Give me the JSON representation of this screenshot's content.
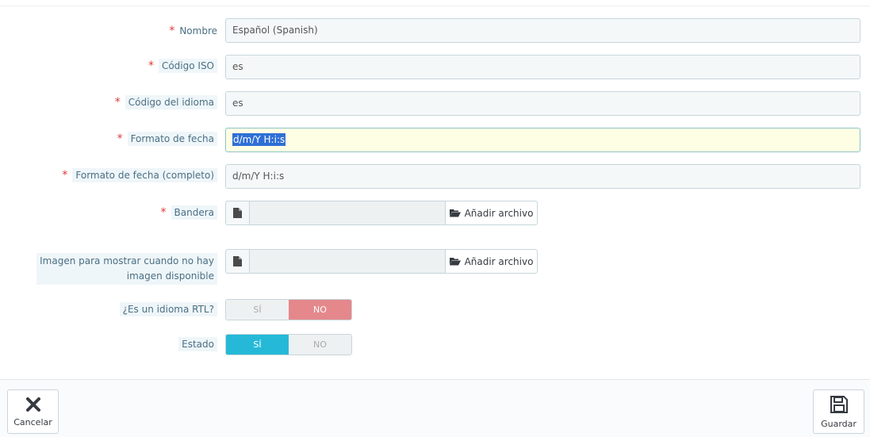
{
  "form": {
    "name": {
      "label": "Nombre",
      "value": "Español (Spanish)"
    },
    "iso_code": {
      "label": "Código ISO",
      "value": "es"
    },
    "language_code": {
      "label": "Código del idioma",
      "value": "es"
    },
    "date_format": {
      "label": "Formato de fecha",
      "value": "d/m/Y H:i:s"
    },
    "date_format_full": {
      "label": "Formato de fecha (completo)",
      "value": "d/m/Y H:i:s"
    },
    "flag": {
      "label": "Bandera",
      "button": "Añadir archivo"
    },
    "no_picture": {
      "label_line1": "Imagen para mostrar cuando no hay",
      "label_line2": "imagen disponible",
      "button": "Añadir archivo"
    },
    "rtl": {
      "label": "¿Es un idioma RTL?",
      "yes": "SÍ",
      "no": "NO",
      "selected": "no"
    },
    "status": {
      "label": "Estado",
      "yes": "SÍ",
      "no": "NO",
      "selected": "yes"
    },
    "required_mark": "*"
  },
  "footer": {
    "cancel": "Cancelar",
    "save": "Guardar"
  },
  "colors": {
    "required": "#e03838",
    "switch_no_active": "#e4888c",
    "switch_yes_active": "#25b9d7",
    "focus_bg": "#fefee5"
  },
  "icons": {
    "file": "file-icon",
    "folder": "folder-open-icon",
    "cancel": "close-icon",
    "save": "floppy-disk-icon"
  }
}
